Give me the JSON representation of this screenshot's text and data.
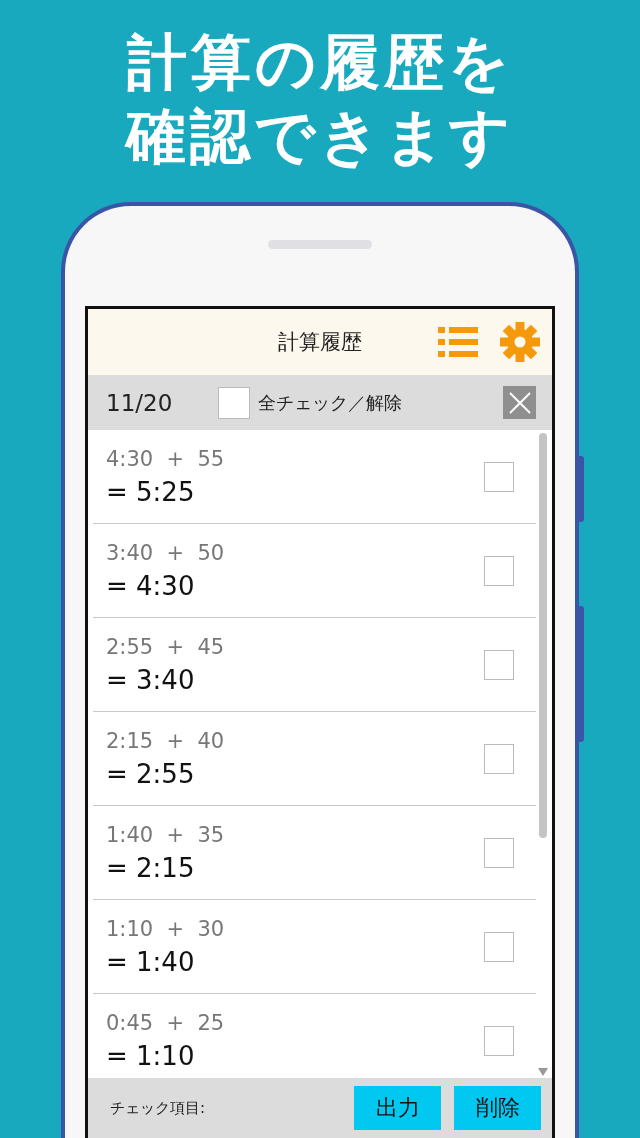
{
  "headline": [
    "計算の履歴を",
    "確認できます"
  ],
  "header": {
    "title": "計算履歴"
  },
  "toolbar": {
    "count": "11/20",
    "select_all": {
      "label": "全チェック／解除",
      "checked": false
    }
  },
  "history": [
    {
      "expression": "4:30  +  55",
      "result": "= 5:25",
      "checked": false
    },
    {
      "expression": "3:40  +  50",
      "result": "= 4:30",
      "checked": false
    },
    {
      "expression": "2:55  +  45",
      "result": "= 3:40",
      "checked": false
    },
    {
      "expression": "2:15  +  40",
      "result": "= 2:55",
      "checked": false
    },
    {
      "expression": "1:40  +  35",
      "result": "= 2:15",
      "checked": false
    },
    {
      "expression": "1:10  +  30",
      "result": "= 1:40",
      "checked": false
    },
    {
      "expression": "0:45  +  25",
      "result": "= 1:10",
      "checked": false
    }
  ],
  "footer": {
    "label": "チェック項目:",
    "buttons": [
      "出力",
      "削除"
    ]
  }
}
